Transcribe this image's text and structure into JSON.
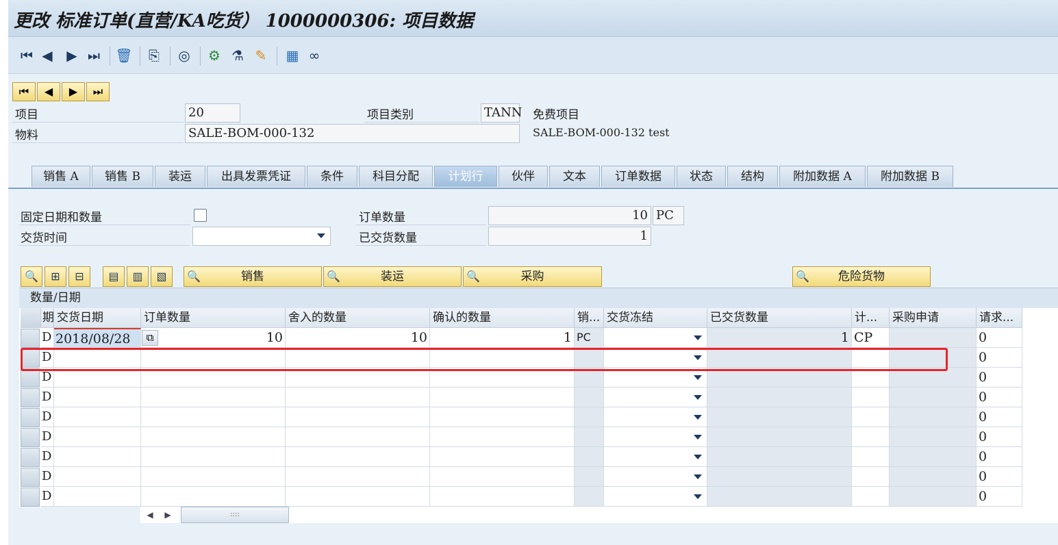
{
  "window": {
    "title": "更改 标准订单(直营/KA吃货） 1000000306: 项目数据"
  },
  "toolbar": {
    "icons": [
      "first-page-icon",
      "prev-page-icon",
      "next-page-icon",
      "last-page-icon",
      "trash-icon",
      "copy-doc-icon",
      "display-doc-icon",
      "config-icon",
      "flask-icon",
      "edit-icon",
      "calculator-icon",
      "glasses-icon"
    ]
  },
  "nav_buttons": [
    "first-icon",
    "prev-icon",
    "next-icon",
    "last-icon"
  ],
  "header": {
    "item_label": "项目",
    "item_value": "20",
    "item_cat_label": "项目类别",
    "item_cat_value": "TANN",
    "item_cat_desc": "免费项目",
    "material_label": "物料",
    "material_value": "SALE-BOM-000-132",
    "material_desc": "SALE-BOM-000-132 test"
  },
  "tabs": [
    {
      "label": "销售 A",
      "active": false
    },
    {
      "label": "销售 B",
      "active": false
    },
    {
      "label": "装运",
      "active": false
    },
    {
      "label": "出具发票凭证",
      "active": false
    },
    {
      "label": "条件",
      "active": false
    },
    {
      "label": "科目分配",
      "active": false
    },
    {
      "label": "计划行",
      "active": true
    },
    {
      "label": "伙伴",
      "active": false
    },
    {
      "label": "文本",
      "active": false
    },
    {
      "label": "订单数据",
      "active": false
    },
    {
      "label": "状态",
      "active": false
    },
    {
      "label": "结构",
      "active": false
    },
    {
      "label": "附加数据 A",
      "active": false
    },
    {
      "label": "附加数据 B",
      "active": false
    }
  ],
  "schedule": {
    "fixed_date_label": "固定日期和数量",
    "fixed_date_checked": false,
    "delivery_time_label": "交货时间",
    "delivery_time_value": "",
    "order_qty_label": "订单数量",
    "order_qty_value": "10",
    "order_qty_unit": "PC",
    "delivered_qty_label": "已交货数量",
    "delivered_qty_value": "1"
  },
  "buttons": {
    "sales": "销售",
    "shipping": "装运",
    "purchasing": "采购",
    "dangerous_goods": "危险货物"
  },
  "grid": {
    "title": "数量/日期",
    "columns": [
      "期",
      "交货日期",
      "订单数量",
      "舍入的数量",
      "确认的数量",
      "销...",
      "交货冻结",
      "已交货数量",
      "计...",
      "采购申请",
      "请求..."
    ],
    "rows": [
      [
        "D",
        "2018/08/28",
        "10",
        "10",
        "1",
        "PC",
        "",
        "1",
        "CP",
        "",
        "0"
      ],
      [
        "D",
        "",
        "",
        "",
        "",
        "",
        "",
        "",
        "",
        "",
        "0"
      ],
      [
        "D",
        "",
        "",
        "",
        "",
        "",
        "",
        "",
        "",
        "",
        "0"
      ],
      [
        "D",
        "",
        "",
        "",
        "",
        "",
        "",
        "",
        "",
        "",
        "0"
      ],
      [
        "D",
        "",
        "",
        "",
        "",
        "",
        "",
        "",
        "",
        "",
        "0"
      ],
      [
        "D",
        "",
        "",
        "",
        "",
        "",
        "",
        "",
        "",
        "",
        "0"
      ],
      [
        "D",
        "",
        "",
        "",
        "",
        "",
        "",
        "",
        "",
        "",
        "0"
      ],
      [
        "D",
        "",
        "",
        "",
        "",
        "",
        "",
        "",
        "",
        "",
        "0"
      ],
      [
        "D",
        "",
        "",
        "",
        "",
        "",
        "",
        "",
        "",
        "",
        "0"
      ]
    ]
  },
  "scroll": {
    "thumb": "::::"
  }
}
